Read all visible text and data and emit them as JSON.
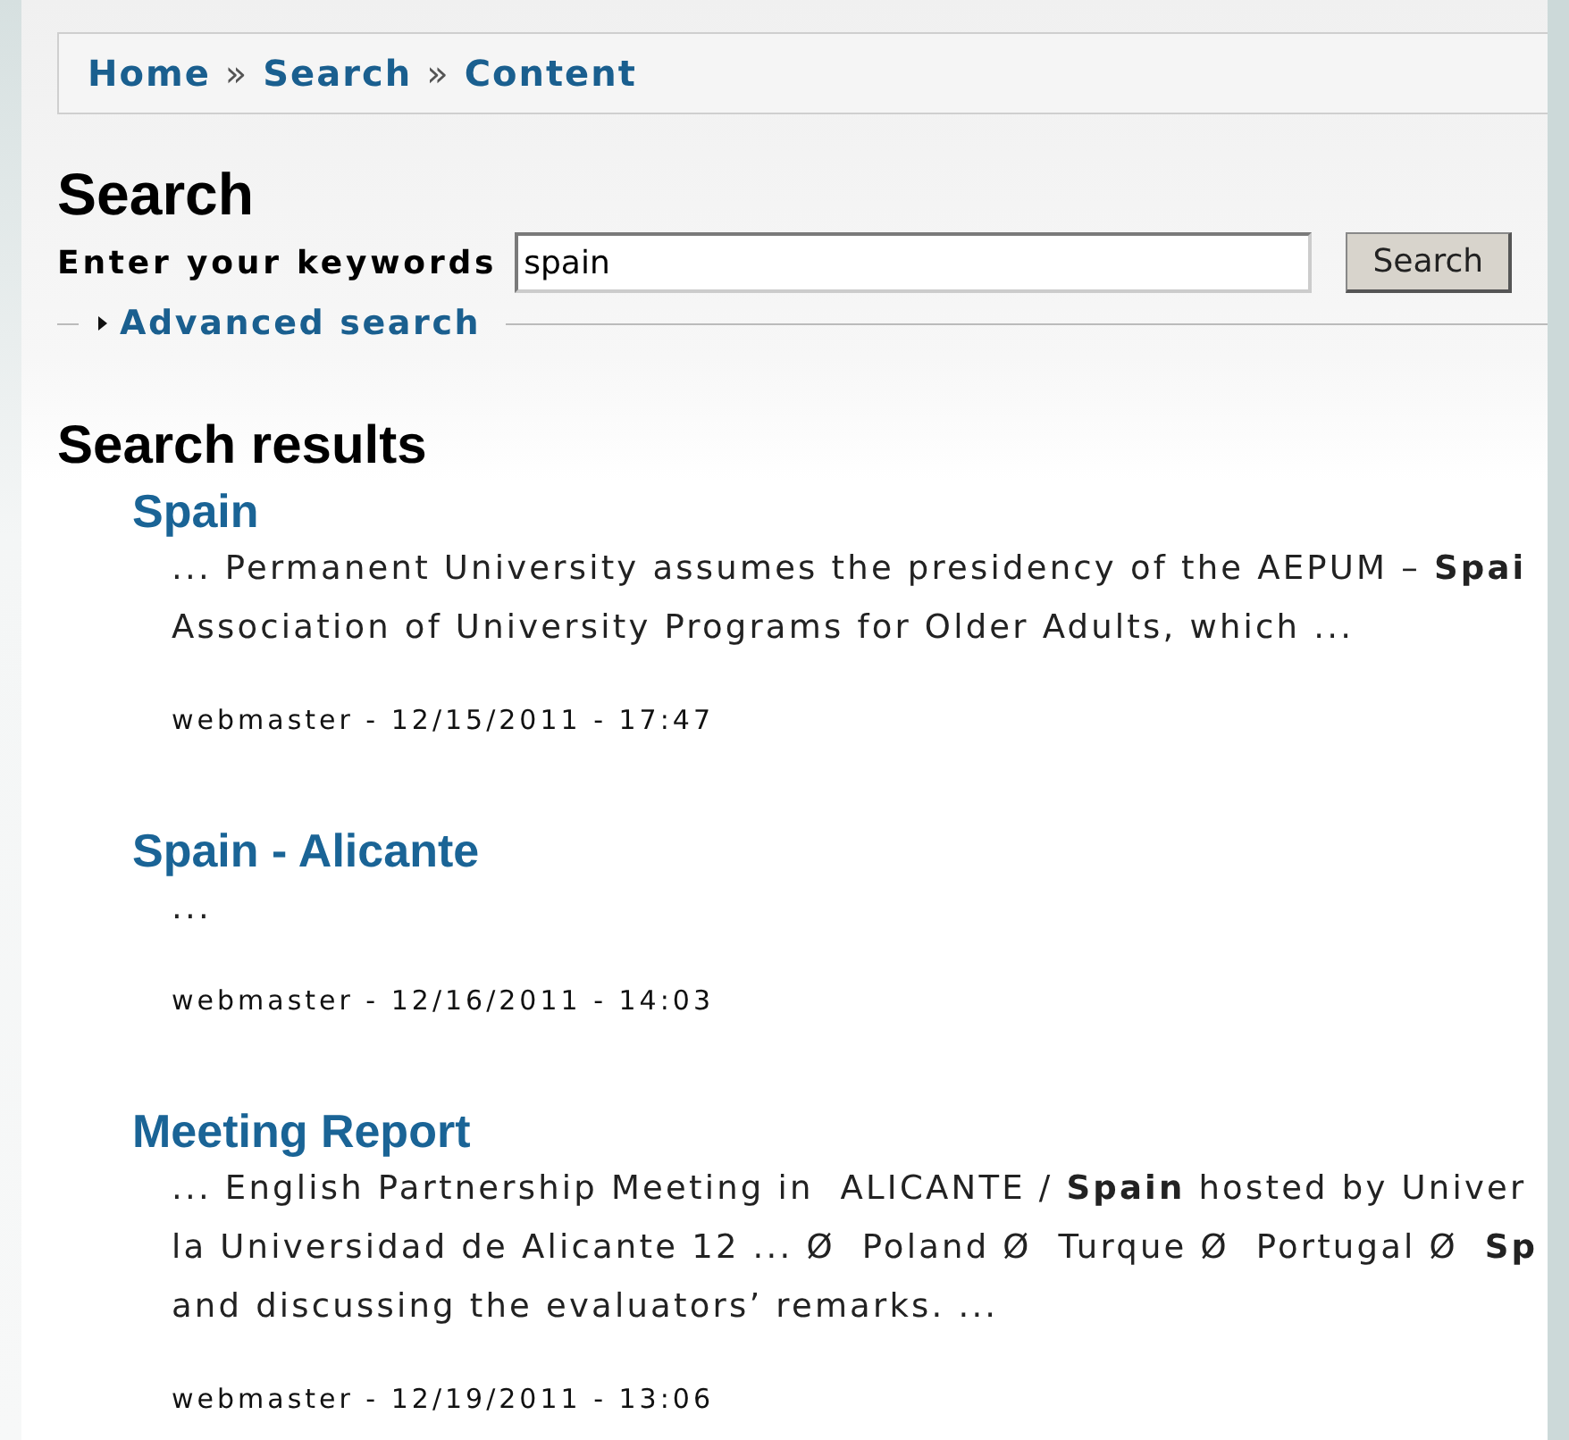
{
  "breadcrumb": {
    "separator": "»",
    "items": [
      "Home",
      "Search",
      "Content"
    ]
  },
  "title": "Search",
  "search_form": {
    "label": "Enter your keywords",
    "value": "spain",
    "button": "Search"
  },
  "advanced_search": {
    "label": "Advanced search",
    "expanded": false
  },
  "results_heading": "Search results",
  "results": [
    {
      "title": "Spain",
      "snippet_lines": [
        "... Permanent University assumes the presidency of the AEPUM – **Spai**",
        "Association of University Programs for Older Adults, which ..."
      ],
      "meta": "webmaster - 12/15/2011 - 17:47"
    },
    {
      "title": "Spain - Alicante",
      "snippet_lines": [
        "..."
      ],
      "meta": "webmaster - 12/16/2011 - 14:03"
    },
    {
      "title": "Meeting Report",
      "snippet_lines": [
        "... English Partnership Meeting in  ALICANTE / **Spain** hosted by Univer",
        "la Universidad de Alicante 12 ... Ø  Poland Ø  Turque Ø  Portugal Ø  **Sp**",
        "and discussing the evaluators’ remarks. ..."
      ],
      "meta": "webmaster - 12/19/2011 - 13:06"
    }
  ]
}
